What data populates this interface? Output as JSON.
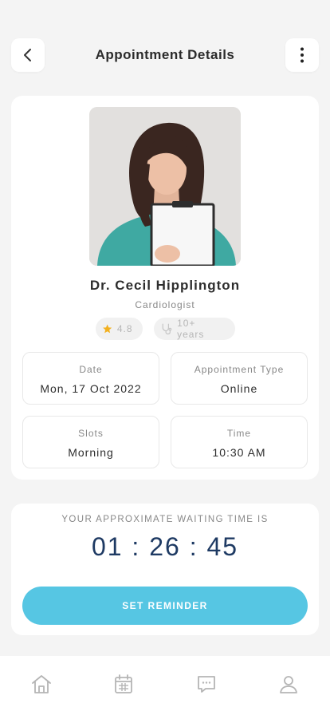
{
  "header": {
    "title": "Appointment Details",
    "back_icon": "chevron-left-icon",
    "menu_icon": "more-vertical-icon"
  },
  "doctor": {
    "name": "Dr. Cecil Hipplington",
    "specialty": "Cardiologist",
    "rating": "4.8",
    "experience": "10+ years"
  },
  "details": {
    "date_label": "Date",
    "date_value": "Mon, 17 Oct 2022",
    "type_label": "Appointment Type",
    "type_value": "Online",
    "slots_label": "Slots",
    "slots_value": "Morning",
    "time_label": "Time",
    "time_value": "10:30 AM"
  },
  "waiting": {
    "label": "YOUR APPROXIMATE WAITING TIME IS",
    "time": "01 : 26 : 45",
    "button_label": "SET REMINDER"
  },
  "nav": {
    "items": [
      "home-icon",
      "calendar-icon",
      "chat-icon",
      "profile-icon"
    ]
  },
  "colors": {
    "accent": "#56c6e3",
    "timer": "#1e3a63",
    "star": "#f2b01e",
    "background": "#f4f4f4"
  }
}
